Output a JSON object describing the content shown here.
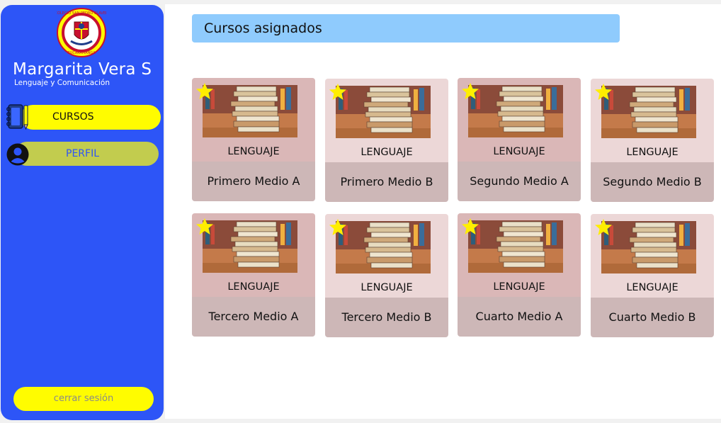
{
  "sidebar": {
    "user_name": "Margarita Vera S",
    "user_subject": "Lenguaje y Comunicación",
    "nav": {
      "cursos_label": "CURSOS",
      "perfil_label": "PERFIL"
    },
    "logout_label": "cerrar sesión",
    "logo_text": "COLEGIO SAN PEDRO CLAVER · BUCARAMANGA"
  },
  "main": {
    "title": "Cursos asignados",
    "courses": [
      {
        "subject": "LENGUAJE",
        "name": "Primero Medio A",
        "favorite": true
      },
      {
        "subject": "LENGUAJE",
        "name": "Primero Medio B",
        "favorite": true
      },
      {
        "subject": "LENGUAJE",
        "name": "Segundo Medio A",
        "favorite": true
      },
      {
        "subject": "LENGUAJE",
        "name": "Segundo Medio B",
        "favorite": true
      },
      {
        "subject": "LENGUAJE",
        "name": "Tercero Medio A",
        "favorite": true
      },
      {
        "subject": "LENGUAJE",
        "name": "Tercero Medio B",
        "favorite": true
      },
      {
        "subject": "LENGUAJE",
        "name": "Cuarto Medio A",
        "favorite": true
      },
      {
        "subject": "LENGUAJE",
        "name": "Cuarto Medio B",
        "favorite": true
      }
    ]
  },
  "icons": {
    "notebook": "notebook-icon",
    "user": "user-icon",
    "star": "star-icon",
    "logo": "school-logo"
  },
  "colors": {
    "sidebar": "#2d55f7",
    "yellow": "#fffc00",
    "perfil": "#c2cc4e",
    "title_bar": "#8fcbfd",
    "card_dark": "#dab7b7",
    "card_light": "#ecd7d7",
    "card_bottom": "#cdb7b7",
    "star": "#ffee00"
  }
}
